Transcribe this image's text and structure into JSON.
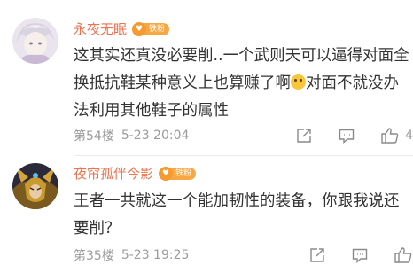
{
  "comments": [
    {
      "username": "永夜无眠",
      "badge_label": "铁粉",
      "text_before_emoji": "这其实还真没必要削..一个武则天可以逼得对面全换抵抗鞋某种意义上也算赚了啊",
      "text_after_emoji": "对面不就没办法利用其他鞋子的属性",
      "floor": "第54楼",
      "time": "5-23 20:04",
      "like_count": "4",
      "icons": [
        "share-icon",
        "reply-icon",
        "like-icon"
      ]
    },
    {
      "username": "夜帘孤伴今影",
      "badge_label": "铁粉",
      "text": "王者一共就这一个能加韧性的装备，你跟我说还要削？",
      "floor": "第35楼",
      "time": "5-23 19:25",
      "icons": [
        "share-icon",
        "reply-icon",
        "like-icon"
      ]
    }
  ],
  "colors": {
    "username": "#eb7350",
    "badge": "#f59a2f",
    "meta": "#9b9b9b",
    "text": "#333333"
  }
}
